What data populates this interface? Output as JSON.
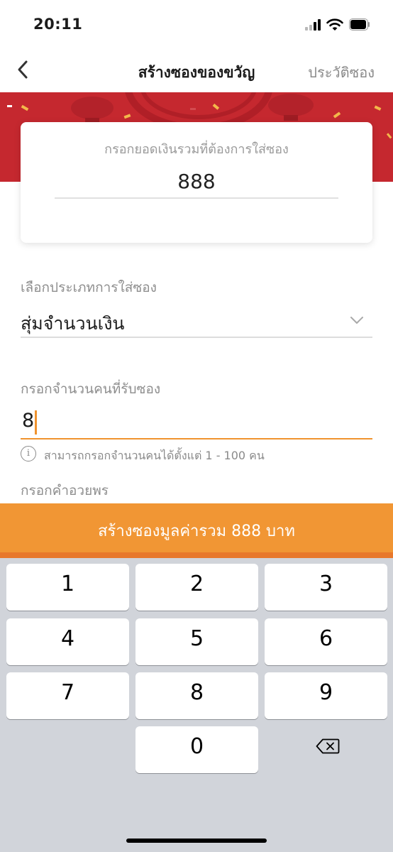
{
  "status": {
    "time": "20:11"
  },
  "nav": {
    "title": "สร้างซองของขวัญ",
    "history": "ประวัติซอง"
  },
  "amount_card": {
    "label": "กรอกยอดเงินรวมที่ต้องการใส่ซอง",
    "value": "888"
  },
  "type": {
    "label": "เลือกประเภทการใส่ซอง",
    "value": "สุ่มจำนวนเงิน"
  },
  "count": {
    "label": "กรอกจำนวนคนที่รับซอง",
    "value": "8",
    "hint": "สามารถกรอกจำนวนคนได้ตั้งแต่ 1 - 100 คน"
  },
  "wish": {
    "label": "กรอกคำอวยพร"
  },
  "create_button": "สร้างซองมูลค่ารวม 888 บาท",
  "keypad": {
    "k1": "1",
    "k2": "2",
    "k3": "3",
    "k4": "4",
    "k5": "5",
    "k6": "6",
    "k7": "7",
    "k8": "8",
    "k9": "9",
    "k0": "0"
  },
  "colors": {
    "accent": "#f19634",
    "banner": "#c5282f",
    "keyboard": "#d1d4da"
  }
}
